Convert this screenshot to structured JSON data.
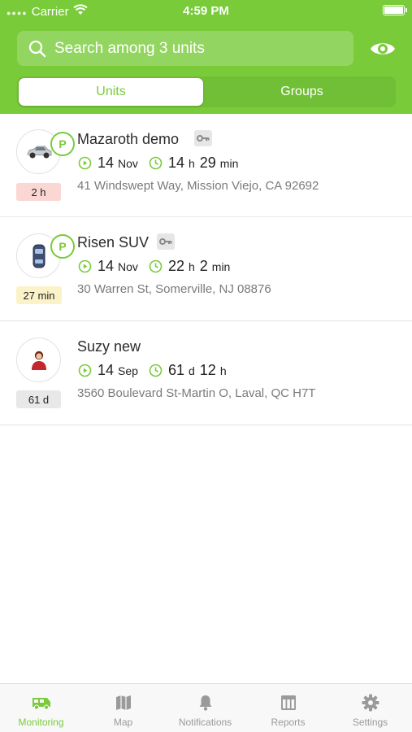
{
  "status_bar": {
    "carrier": "Carrier",
    "time": "4:59 PM"
  },
  "search": {
    "placeholder": "Search among 3 units"
  },
  "segments": {
    "units": "Units",
    "groups": "Groups",
    "active": "Units"
  },
  "colors": {
    "accent": "#79cb3a",
    "age_red": "#fbd7d3",
    "age_yellow": "#fbf2c8",
    "age_grey": "#e8e8e8"
  },
  "units": [
    {
      "name": "Mazaroth demo",
      "icon": "car-icon",
      "parked": "P",
      "has_key": true,
      "age": "2 h",
      "date_day": "14",
      "date_month": "Nov",
      "duration_1_value": "14",
      "duration_1_unit": "h",
      "duration_2_value": "29",
      "duration_2_unit": "min",
      "address": "41 Windswept Way, Mission Viejo, CA 92692"
    },
    {
      "name": "Risen SUV",
      "icon": "suv-icon",
      "parked": "P",
      "has_key": true,
      "age": "27 min",
      "date_day": "14",
      "date_month": "Nov",
      "duration_1_value": "22",
      "duration_1_unit": "h",
      "duration_2_value": "2",
      "duration_2_unit": "min",
      "address": "30 Warren St, Somerville, NJ 08876"
    },
    {
      "name": "Suzy new",
      "icon": "person-icon",
      "parked": "",
      "has_key": false,
      "age": "61 d",
      "date_day": "14",
      "date_month": "Sep",
      "duration_1_value": "61",
      "duration_1_unit": "d",
      "duration_2_value": "12",
      "duration_2_unit": "h",
      "address": "3560 Boulevard St-Martin O, Laval, QC H7T"
    }
  ],
  "tabbar": [
    {
      "label": "Monitoring",
      "icon": "van-icon",
      "active": true
    },
    {
      "label": "Map",
      "icon": "map-icon",
      "active": false
    },
    {
      "label": "Notifications",
      "icon": "bell-icon",
      "active": false
    },
    {
      "label": "Reports",
      "icon": "reports-icon",
      "active": false
    },
    {
      "label": "Settings",
      "icon": "gear-icon",
      "active": false
    }
  ]
}
